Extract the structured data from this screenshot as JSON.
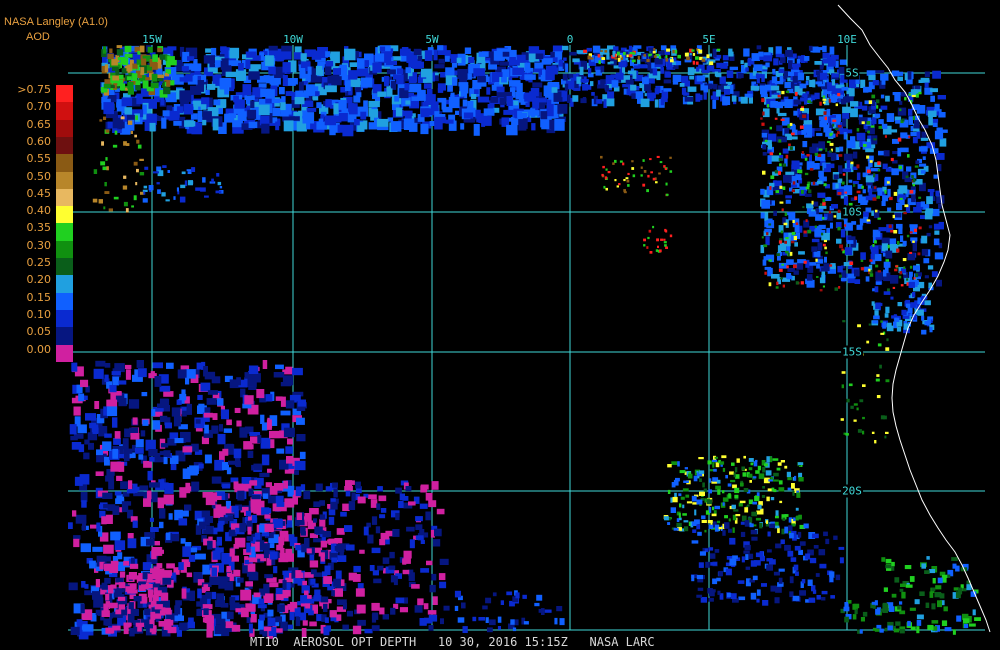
{
  "header": {
    "source": "NASA Langley (A1.0)",
    "product": "AOD"
  },
  "color_scale": [
    {
      "label": ">0.75",
      "color": "#ff2020"
    },
    {
      "label": "0.70",
      "color": "#d01010"
    },
    {
      "label": "0.65",
      "color": "#a00c0c"
    },
    {
      "label": "0.60",
      "color": "#6e1010"
    },
    {
      "label": "0.55",
      "color": "#8a5a14"
    },
    {
      "label": "0.50",
      "color": "#b8862a"
    },
    {
      "label": "0.45",
      "color": "#e8b860"
    },
    {
      "label": "0.40",
      "color": "#ffff30"
    },
    {
      "label": "0.35",
      "color": "#20d020"
    },
    {
      "label": "0.30",
      "color": "#109010"
    },
    {
      "label": "0.25",
      "color": "#0a5e1a"
    },
    {
      "label": "0.20",
      "color": "#20a0e0"
    },
    {
      "label": "0.15",
      "color": "#1060ff"
    },
    {
      "label": "0.10",
      "color": "#0a2ad0"
    },
    {
      "label": "0.05",
      "color": "#061680"
    },
    {
      "label": "0.00",
      "color": "#d020a0"
    }
  ],
  "longitude_labels": [
    "15W",
    "10W",
    "5W",
    "0",
    "5E",
    "10E"
  ],
  "latitude_labels": [
    "5S",
    "10S",
    "15S",
    "20S"
  ],
  "caption": "MT10  AEROSOL OPT DEPTH   10 30, 2016 15:15Z   NASA LARC",
  "colors": {
    "grid": "#3fd9d9",
    "coastline": "#ffffff",
    "background": "#000000"
  }
}
